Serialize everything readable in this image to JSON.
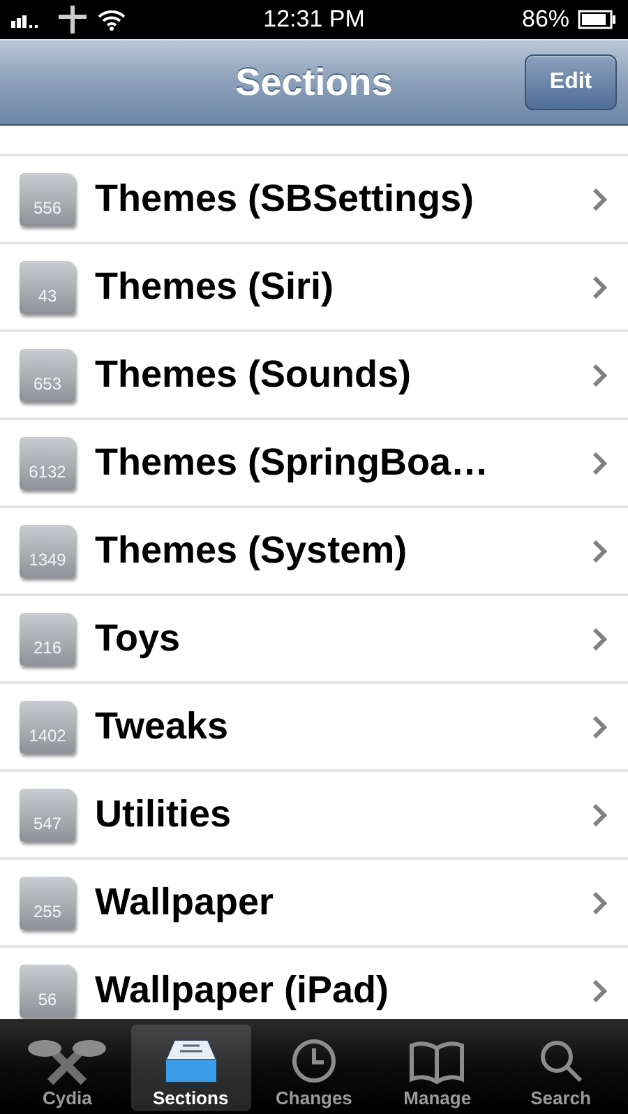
{
  "status_bar": {
    "time": "12:31 PM",
    "battery": "86%"
  },
  "nav_bar": {
    "title": "Sections",
    "button": "Edit"
  },
  "sections": [
    {
      "count": "556",
      "name": "Themes (SBSettings)"
    },
    {
      "count": "43",
      "name": "Themes (Siri)"
    },
    {
      "count": "653",
      "name": "Themes (Sounds)"
    },
    {
      "count": "6132",
      "name": "Themes (SpringBoa…"
    },
    {
      "count": "1349",
      "name": "Themes (System)"
    },
    {
      "count": "216",
      "name": "Toys"
    },
    {
      "count": "1402",
      "name": "Tweaks"
    },
    {
      "count": "547",
      "name": "Utilities"
    },
    {
      "count": "255",
      "name": "Wallpaper"
    },
    {
      "count": "56",
      "name": "Wallpaper (iPad)"
    }
  ],
  "tab_bar": [
    {
      "kind": "cydia",
      "label": "Cydia",
      "selected": false
    },
    {
      "kind": "sections",
      "label": "Sections",
      "selected": true
    },
    {
      "kind": "changes",
      "label": "Changes",
      "selected": false
    },
    {
      "kind": "manage",
      "label": "Manage",
      "selected": false
    },
    {
      "kind": "search",
      "label": "Search",
      "selected": false
    }
  ]
}
